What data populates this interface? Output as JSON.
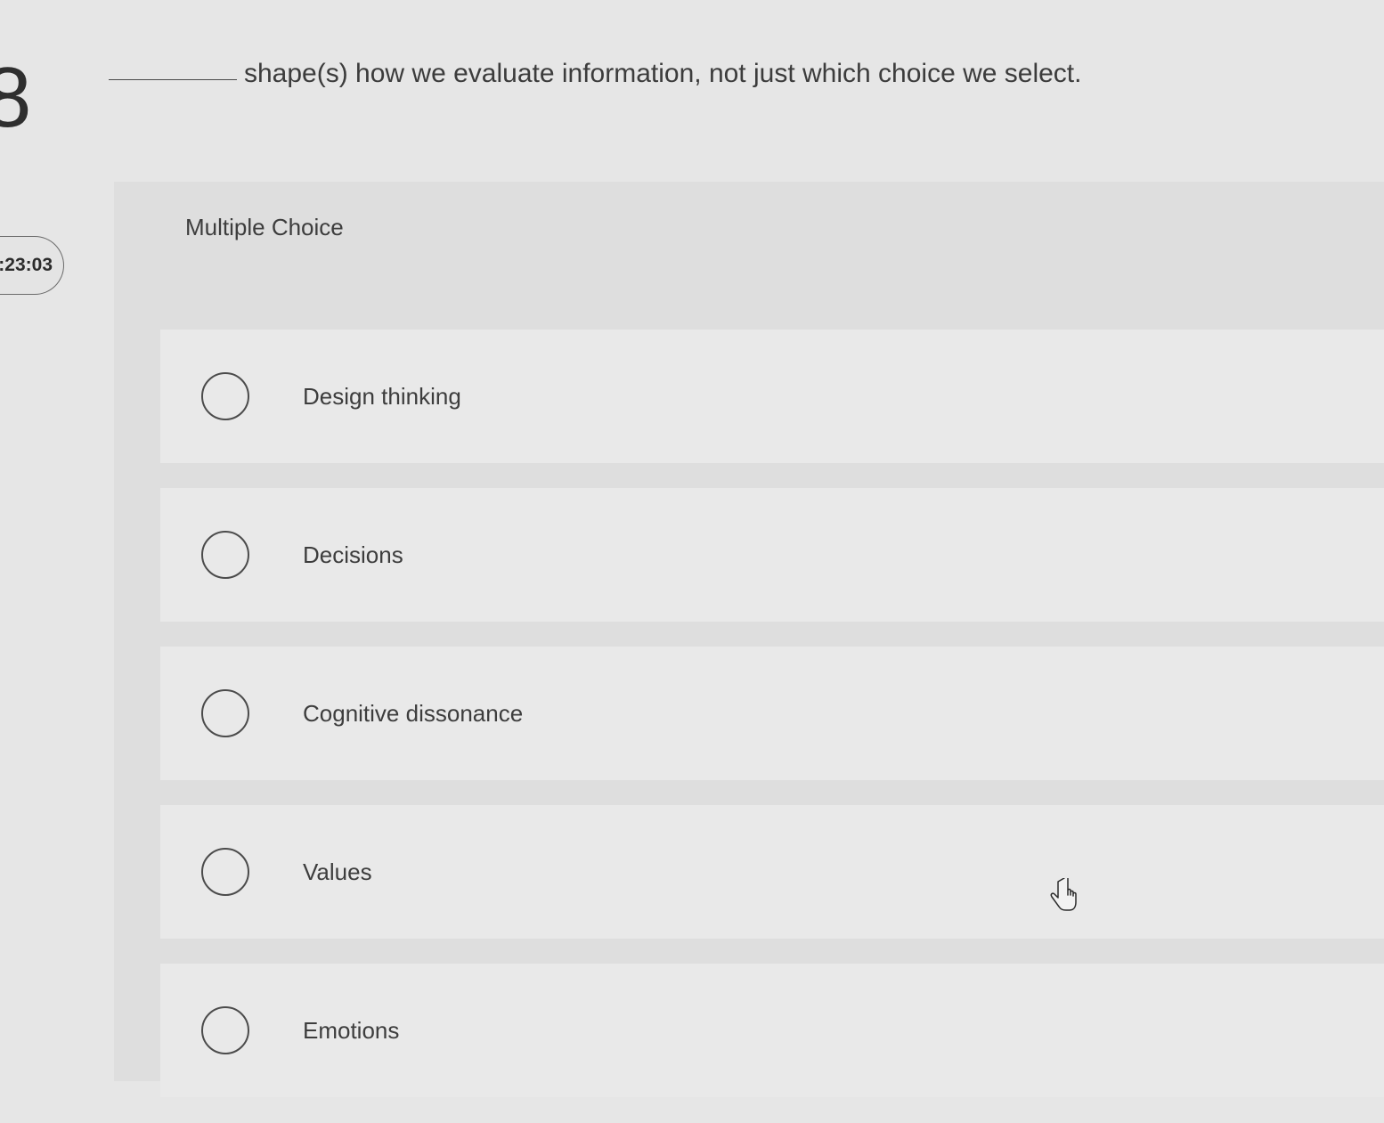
{
  "question": {
    "number": "8",
    "text": "shape(s) how we evaluate information, not just which choice we select."
  },
  "timer": {
    "value": ":23:03"
  },
  "question_type": "Multiple Choice",
  "options": [
    {
      "label": "Design thinking",
      "selected": false
    },
    {
      "label": "Decisions",
      "selected": false
    },
    {
      "label": "Cognitive dissonance",
      "selected": false
    },
    {
      "label": "Values",
      "selected": false
    },
    {
      "label": "Emotions",
      "selected": false
    }
  ],
  "icons": {
    "radio": "radio-button-icon",
    "cursor": "hand-pointer-icon"
  },
  "colors": {
    "background": "#e6e6e6",
    "panel": "#dedede",
    "option_row": "#e9e9e9",
    "text": "#3d3d3d"
  }
}
